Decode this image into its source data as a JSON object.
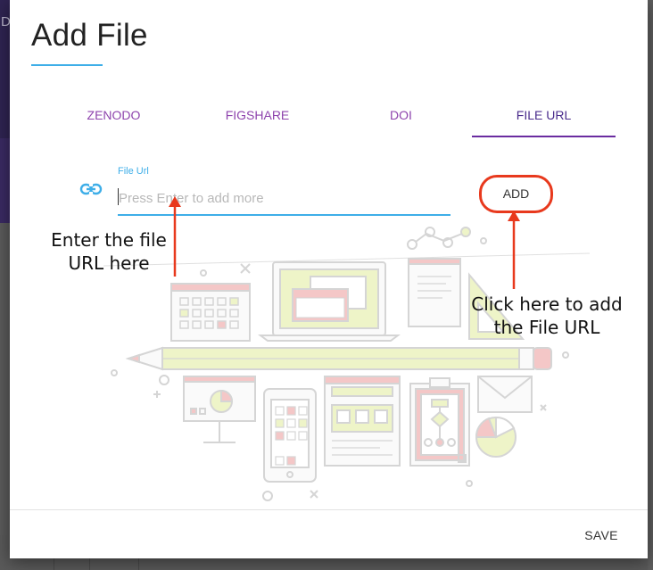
{
  "background": {
    "sidebar_glyph": "D"
  },
  "dialog": {
    "title": "Add File",
    "tabs": [
      {
        "label": "ZENODO",
        "active": false
      },
      {
        "label": "FIGSHARE",
        "active": false
      },
      {
        "label": "DOI",
        "active": false
      },
      {
        "label": "FILE URL",
        "active": true
      }
    ],
    "file_url": {
      "label": "File Url",
      "placeholder": "Press Enter to add more",
      "value": ""
    },
    "add_label": "ADD",
    "save_label": "SAVE"
  },
  "annotations": {
    "enter_url": "Enter the file URL here",
    "click_add": "Click here to add the File URL"
  },
  "colors": {
    "accent_blue": "#3eaee8",
    "tab_purple": "#8e44ad",
    "tab_active": "#4a2c8c",
    "callout_red": "#e8391d"
  },
  "icons": [
    "link-icon",
    "arrow-up-icon"
  ]
}
